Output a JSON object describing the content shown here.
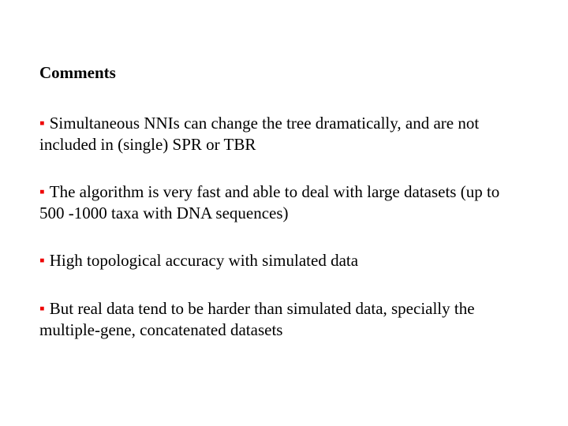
{
  "title": "Comments",
  "bullets": [
    "Simultaneous NNIs can change the tree dramatically, and are not included in (single) SPR or TBR",
    "The algorithm is very fast and able to deal with large datasets (up to 500 -1000 taxa with DNA sequences)",
    "High topological accuracy with simulated data",
    "But real data tend to be harder than simulated data, specially the multiple-gene, concatenated datasets"
  ]
}
